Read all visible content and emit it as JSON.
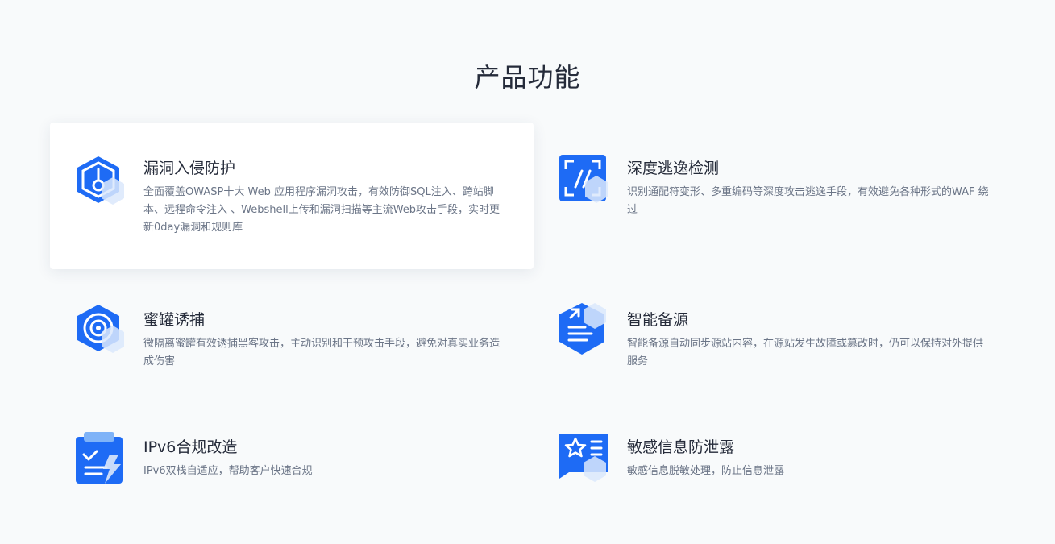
{
  "section": {
    "title": "产品功能"
  },
  "features": [
    {
      "name": "漏洞入侵防护",
      "desc": "全面覆盖OWASP十大 Web 应用程序漏洞攻击，有效防御SQL注入、跨站脚本、远程命令注入 、Webshell上传和漏洞扫描等主流Web攻击手段，实时更新0day漏洞和规则库",
      "icon": "shield-icon"
    },
    {
      "name": "深度逃逸检测",
      "desc": "识别通配符变形、多重编码等深度攻击逃逸手段，有效避免各种形式的WAF 绕过",
      "icon": "scan-icon"
    },
    {
      "name": "蜜罐诱捕",
      "desc": "微隔离蜜罐有效诱捕黑客攻击，主动识别和干预攻击手段，避免对真实业务造成伤害",
      "icon": "target-icon"
    },
    {
      "name": "智能备源",
      "desc": "智能备源自动同步源站内容，在源站发生故障或篡改时，仍可以保持对外提供服务",
      "icon": "document-icon"
    },
    {
      "name": "IPv6合规改造",
      "desc": "IPv6双栈自适应，帮助客户快速合规",
      "icon": "clipboard-check-icon"
    },
    {
      "name": "敏感信息防泄露",
      "desc": "敏感信息脱敏处理，防止信息泄露",
      "icon": "star-chat-icon"
    }
  ],
  "colors": {
    "accent": "#1e6bf5",
    "accent_light": "#7fb3f8",
    "background": "#f8fafb"
  }
}
